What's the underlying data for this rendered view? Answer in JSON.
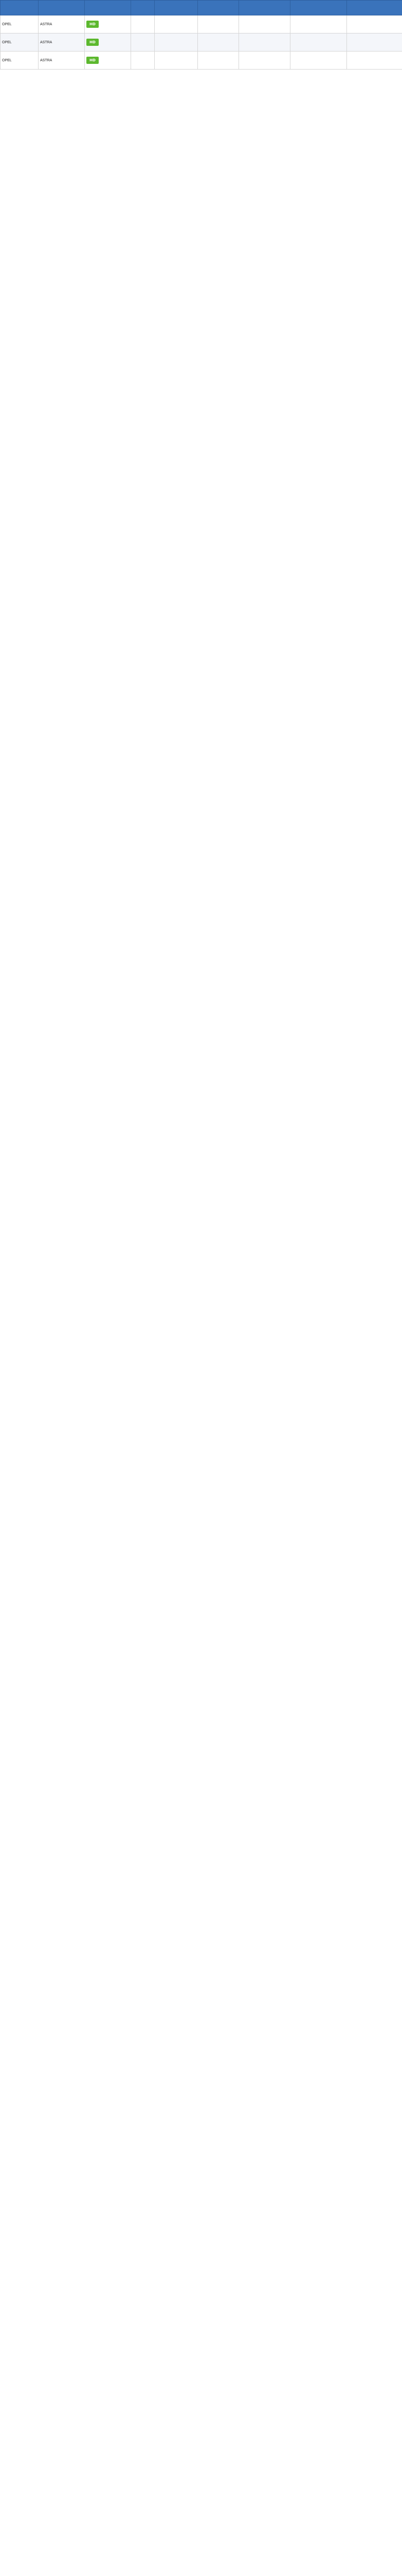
{
  "brand": {
    "accent": "#3a73bb",
    "badge_green": "#5cb82e",
    "badge_gray": "#6b6b6b"
  },
  "table": {
    "columns": [
      "",
      "",
      "",
      "",
      "",
      "",
      "",
      "",
      ""
    ],
    "rows": [
      {
        "make": "OPEL",
        "model": "ASTRA",
        "badge": "HD",
        "badge_color": "green"
      },
      {
        "make": "OPEL",
        "model": "ASTRA",
        "badge": "HD",
        "badge_color": "green"
      },
      {
        "make": "OPEL",
        "model": "ASTRA",
        "badge": "HD",
        "badge_color": "green"
      }
    ]
  }
}
